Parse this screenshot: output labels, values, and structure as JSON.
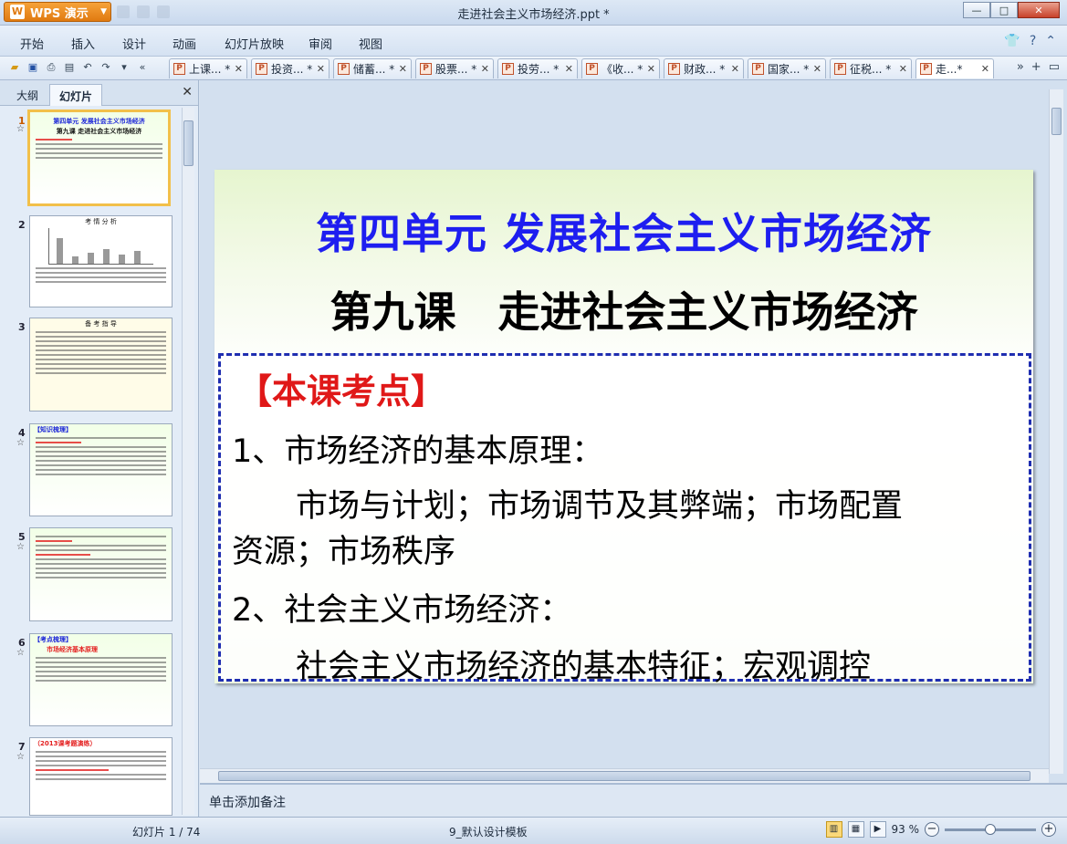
{
  "app": {
    "name": "WPS 演示",
    "logo": "W"
  },
  "window": {
    "title": "走进社会主义市场经济.ppt *"
  },
  "menu": [
    "开始",
    "插入",
    "设计",
    "动画",
    "幻灯片放映",
    "审阅",
    "视图"
  ],
  "doc_tabs": [
    {
      "label": "上课... *"
    },
    {
      "label": "投资... *"
    },
    {
      "label": "储蓄... *"
    },
    {
      "label": "股票... *"
    },
    {
      "label": "投劳... *"
    },
    {
      "label": "《收... *"
    },
    {
      "label": "财政... *"
    },
    {
      "label": "国家... *"
    },
    {
      "label": "征税... *"
    },
    {
      "label": "走...*"
    }
  ],
  "panel": {
    "tab_outline": "大纲",
    "tab_slides": "幻灯片"
  },
  "thumbnails": [
    {
      "num": "1",
      "star": "☆",
      "title": "第四单元 发展社会主义市场经济",
      "sub": "第九课 走进社会主义市场经济"
    },
    {
      "num": "2",
      "star": "",
      "title": "考 情 分 析",
      "sub": ""
    },
    {
      "num": "3",
      "star": "",
      "title": "备 考 指 导",
      "sub": ""
    },
    {
      "num": "4",
      "star": "☆",
      "title": "【知识梳理】",
      "sub": ""
    },
    {
      "num": "5",
      "star": "☆",
      "title": "",
      "sub": ""
    },
    {
      "num": "6",
      "star": "☆",
      "title": "【考点梳理】",
      "sub": "市场经济基本原理"
    },
    {
      "num": "7",
      "star": "☆",
      "title": "（2013课考题演练）",
      "sub": ""
    }
  ],
  "slide": {
    "title": "第四单元 发展社会主义市场经济",
    "subtitle": "第九课　走进社会主义市场经济",
    "box_heading": "【本课考点】",
    "lines": [
      "1、市场经济的基本原理：",
      "　　市场与计划；市场调节及其弊端；市场配置",
      "资源；市场秩序",
      "2、社会主义市场经济：",
      "　　社会主义市场经济的基本特征；宏观调控"
    ]
  },
  "notes": {
    "placeholder": "单击添加备注"
  },
  "status": {
    "slide_counter": "幻灯片 1 / 74",
    "template": "9_默认设计模板",
    "zoom": "93 %"
  },
  "colors": {
    "title_blue": "#1e1ef0",
    "heading_red": "#e01818",
    "border_blue": "#1e2db0",
    "app_orange": "#e07a10"
  }
}
